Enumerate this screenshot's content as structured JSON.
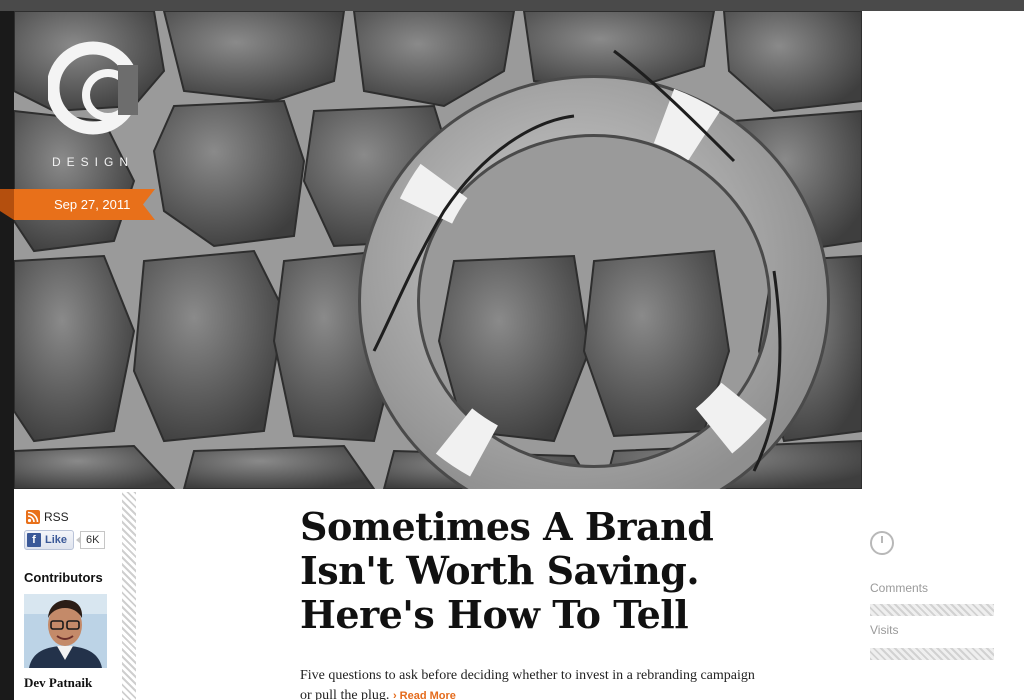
{
  "brand": {
    "logo_word": "DESIGN"
  },
  "post": {
    "date": "Sep 27, 2011",
    "title_lines": [
      "Sometimes A Brand",
      "Isn't Worth Saving.",
      "Here's How To Tell"
    ],
    "dek": "Five questions to ask before deciding whether to invest in a rebranding campaign or pull the plug.",
    "read_more": "Read More"
  },
  "sidebar": {
    "rss_label": "RSS",
    "like_label": "Like",
    "like_count": "6K",
    "contributors_title": "Contributors",
    "contributor_name": "Dev Patnaik"
  },
  "stats": {
    "comments_label": "Comments",
    "visits_label": "Visits"
  },
  "colors": {
    "accent": "#e8701a",
    "topbar": "#4a4a4a",
    "facebook": "#3b5998"
  },
  "icons": [
    "rss-icon",
    "facebook-icon",
    "clock-icon"
  ]
}
